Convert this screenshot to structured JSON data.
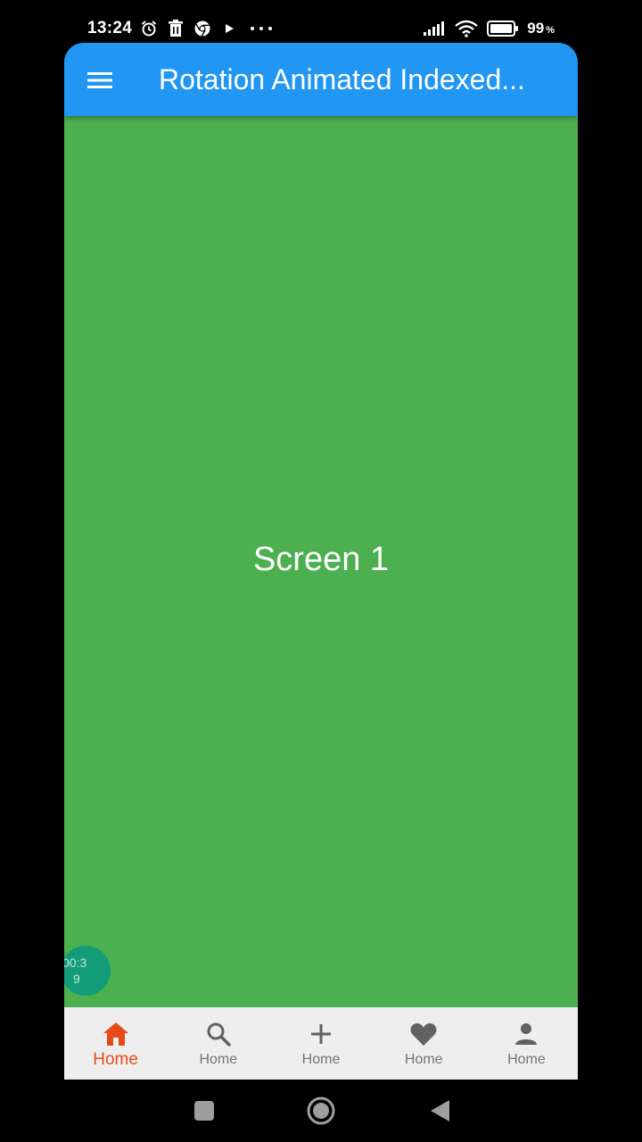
{
  "status_bar": {
    "time": "13:24",
    "battery_value": "99",
    "battery_unit": "%"
  },
  "app_bar": {
    "title": "Rotation Animated Indexed..."
  },
  "content": {
    "screen_label": "Screen 1"
  },
  "timer": {
    "line1": "00:3",
    "line2": "9"
  },
  "bottom_nav": {
    "items": [
      {
        "label": "Home",
        "icon": "home-icon",
        "active": true
      },
      {
        "label": "Home",
        "icon": "search-icon",
        "active": false
      },
      {
        "label": "Home",
        "icon": "add-icon",
        "active": false
      },
      {
        "label": "Home",
        "icon": "heart-icon",
        "active": false
      },
      {
        "label": "Home",
        "icon": "person-icon",
        "active": false
      }
    ]
  },
  "colors": {
    "app_bar": "#2196F3",
    "body": "#4CAF50",
    "active_nav": "#E64A19",
    "inactive_nav": "#757575",
    "nav_background": "#EEEEEE"
  }
}
